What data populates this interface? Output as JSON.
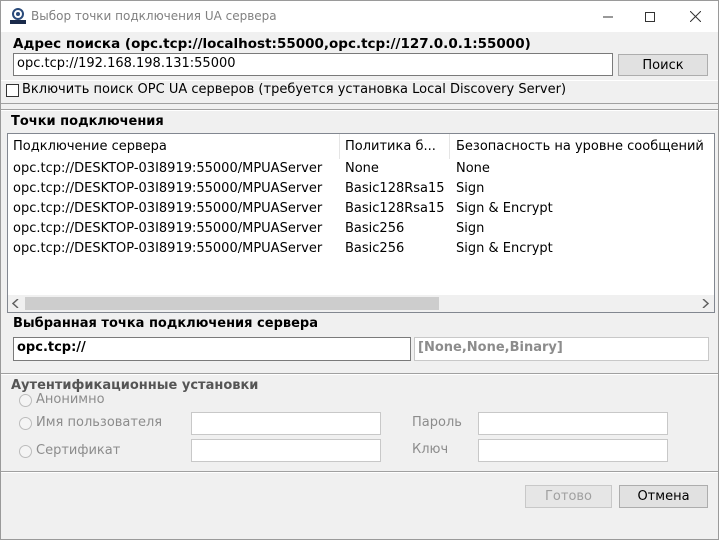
{
  "window": {
    "title": "Выбор точки подключения UA сервера",
    "icon_name": "opc-logo-icon",
    "controls": [
      "minimize",
      "maximize",
      "close"
    ]
  },
  "search": {
    "label": "Адрес поиска (opc.tcp://localhost:55000,opc.tcp://127.0.0.1:55000)",
    "value": "opc.tcp://192.168.198.131:55000",
    "button": "Поиск"
  },
  "discovery_checkbox": {
    "label": "Включить поиск OPC UA серверов (требуется установка Local Discovery Server)",
    "checked": false
  },
  "endpoints": {
    "section_title": "Точки подключения",
    "columns": [
      "Подключение сервера",
      "Политика б...",
      "Безопасность на уровне сообщений"
    ],
    "rows": [
      [
        "opc.tcp://DESKTOP-03I8919:55000/MPUAServer",
        "None",
        "None"
      ],
      [
        "opc.tcp://DESKTOP-03I8919:55000/MPUAServer",
        "Basic128Rsa15",
        "Sign"
      ],
      [
        "opc.tcp://DESKTOP-03I8919:55000/MPUAServer",
        "Basic128Rsa15",
        "Sign & Encrypt"
      ],
      [
        "opc.tcp://DESKTOP-03I8919:55000/MPUAServer",
        "Basic256",
        "Sign"
      ],
      [
        "opc.tcp://DESKTOP-03I8919:55000/MPUAServer",
        "Basic256",
        "Sign & Encrypt"
      ]
    ]
  },
  "selected": {
    "section_title": "Выбранная точка подключения сервера",
    "url": "opc.tcp://",
    "settings": "[None,None,Binary]"
  },
  "auth": {
    "section_title": "Аутентификационные установки",
    "anonymous": "Анонимно",
    "username": "Имя пользователя",
    "certificate": "Сертификат",
    "password": "Пароль",
    "key": "Ключ"
  },
  "footer": {
    "ok": "Готово",
    "cancel": "Отмена"
  }
}
